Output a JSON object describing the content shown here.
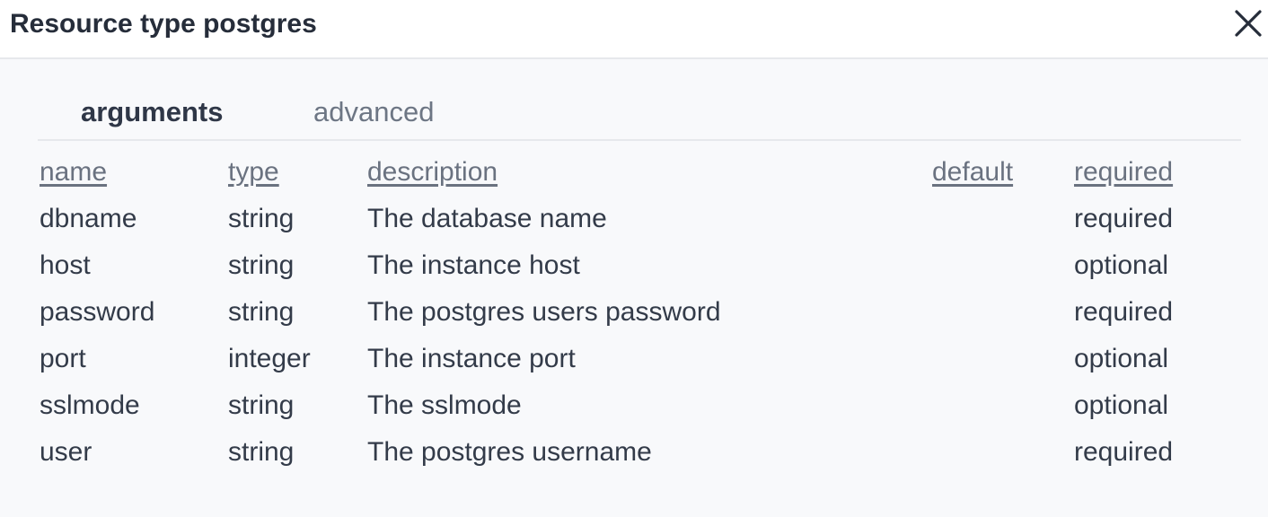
{
  "dialog": {
    "title": "Resource type postgres",
    "close_icon": "close-icon"
  },
  "tabs": [
    {
      "label": "arguments",
      "active": true
    },
    {
      "label": "advanced",
      "active": false
    }
  ],
  "table": {
    "headers": [
      "name",
      "type",
      "description",
      "default",
      "required"
    ],
    "rows": [
      {
        "name": "dbname",
        "type": "string",
        "description": "The database name",
        "default": "",
        "required": "required"
      },
      {
        "name": "host",
        "type": "string",
        "description": "The instance host",
        "default": "",
        "required": "optional"
      },
      {
        "name": "password",
        "type": "string",
        "description": "The postgres users password",
        "default": "",
        "required": "required"
      },
      {
        "name": "port",
        "type": "integer",
        "description": "The instance port",
        "default": "",
        "required": "optional"
      },
      {
        "name": "sslmode",
        "type": "string",
        "description": "The sslmode",
        "default": "",
        "required": "optional"
      },
      {
        "name": "user",
        "type": "string",
        "description": "The postgres username",
        "default": "",
        "required": "required"
      }
    ]
  },
  "colors": {
    "background": "#f8f9fb",
    "header_background": "#ffffff",
    "text": "#333b49",
    "muted_text": "#6d7684",
    "divider": "#e6e8ec"
  }
}
